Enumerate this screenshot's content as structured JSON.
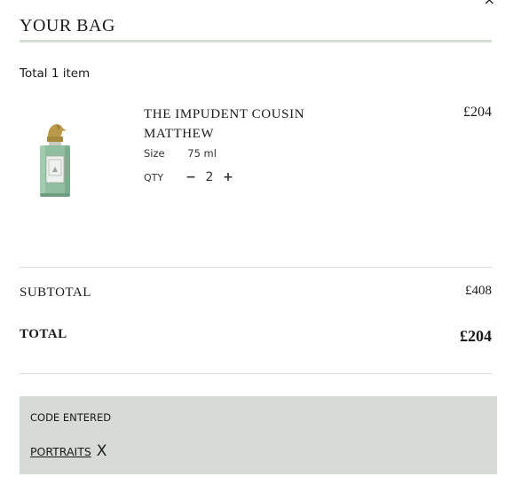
{
  "header": {
    "close_glyph": "×",
    "title": "YOUR BAG"
  },
  "summary": {
    "total_items": "Total 1 item"
  },
  "item": {
    "name": "THE IMPUDENT COUSIN MATTHEW",
    "price": "£204",
    "size_label": "Size",
    "size_value": "75 ml",
    "qty_label": "QTY",
    "qty_minus": "−",
    "qty_value": "2",
    "qty_plus": "+",
    "image_icon": "perfume-bottle-icon"
  },
  "totals": {
    "subtotal_label": "SUBTOTAL",
    "subtotal_value": "£408",
    "total_label": "TOTAL",
    "total_value": "£204"
  },
  "promo": {
    "heading": "CODE ENTERED",
    "code": "PORTRAITS",
    "remove": "X"
  },
  "colors": {
    "accent_panel": "#d6dbd8",
    "bottle_glass": "#8fbfa0",
    "bottle_cap": "#b89a4a"
  }
}
